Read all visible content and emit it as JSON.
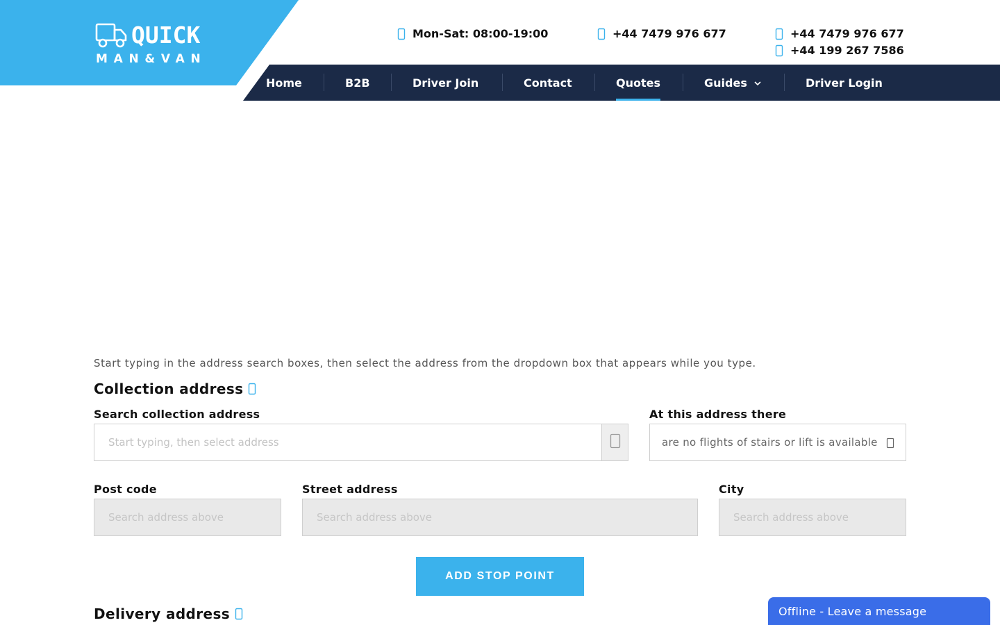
{
  "brand": {
    "line1": "QUICK",
    "line2": "MAN&VAN",
    "color": "#3bb2ec"
  },
  "contacts": {
    "hours": {
      "icon": "clock-icon",
      "text": "Mon-Sat: 08:00-19:00"
    },
    "mobile": {
      "icon": "mobile-phone-icon",
      "text": "+44 7479 976 677"
    },
    "phones": [
      {
        "icon": "phone-icon",
        "text": "+44 7479 976 677"
      },
      {
        "icon": "phone-icon",
        "text": "+44 199 267 7586"
      }
    ]
  },
  "nav": {
    "items": [
      {
        "label": "Home"
      },
      {
        "label": "B2B"
      },
      {
        "label": "Driver Join"
      },
      {
        "label": "Contact"
      },
      {
        "label": "Quotes",
        "active": true
      },
      {
        "label": "Guides",
        "icon": "chevron-down-icon"
      },
      {
        "label": "Driver Login"
      }
    ],
    "background": "#1b2a47"
  },
  "form": {
    "intro": "Start typing in the address search boxes, then select the address from the dropdown box that appears while you type.",
    "collection": {
      "title": "Collection address",
      "title_icon": "info-icon",
      "search_label": "Search collection address",
      "search_placeholder": "Start typing, then select address",
      "search_icon": "search-icon",
      "access_label": "At this address there",
      "access_value": "are no flights of stairs or lift is available",
      "postcode_label": "Post code",
      "postcode_placeholder": "Search address above",
      "street_label": "Street address",
      "street_placeholder": "Search address above",
      "city_label": "City",
      "city_placeholder": "Search address above"
    },
    "add_stop_label": "ADD STOP POINT",
    "delivery": {
      "title": "Delivery address",
      "title_icon": "info-icon"
    }
  },
  "chat": {
    "label": "Offline - Leave a message",
    "color": "#3a6de8"
  }
}
